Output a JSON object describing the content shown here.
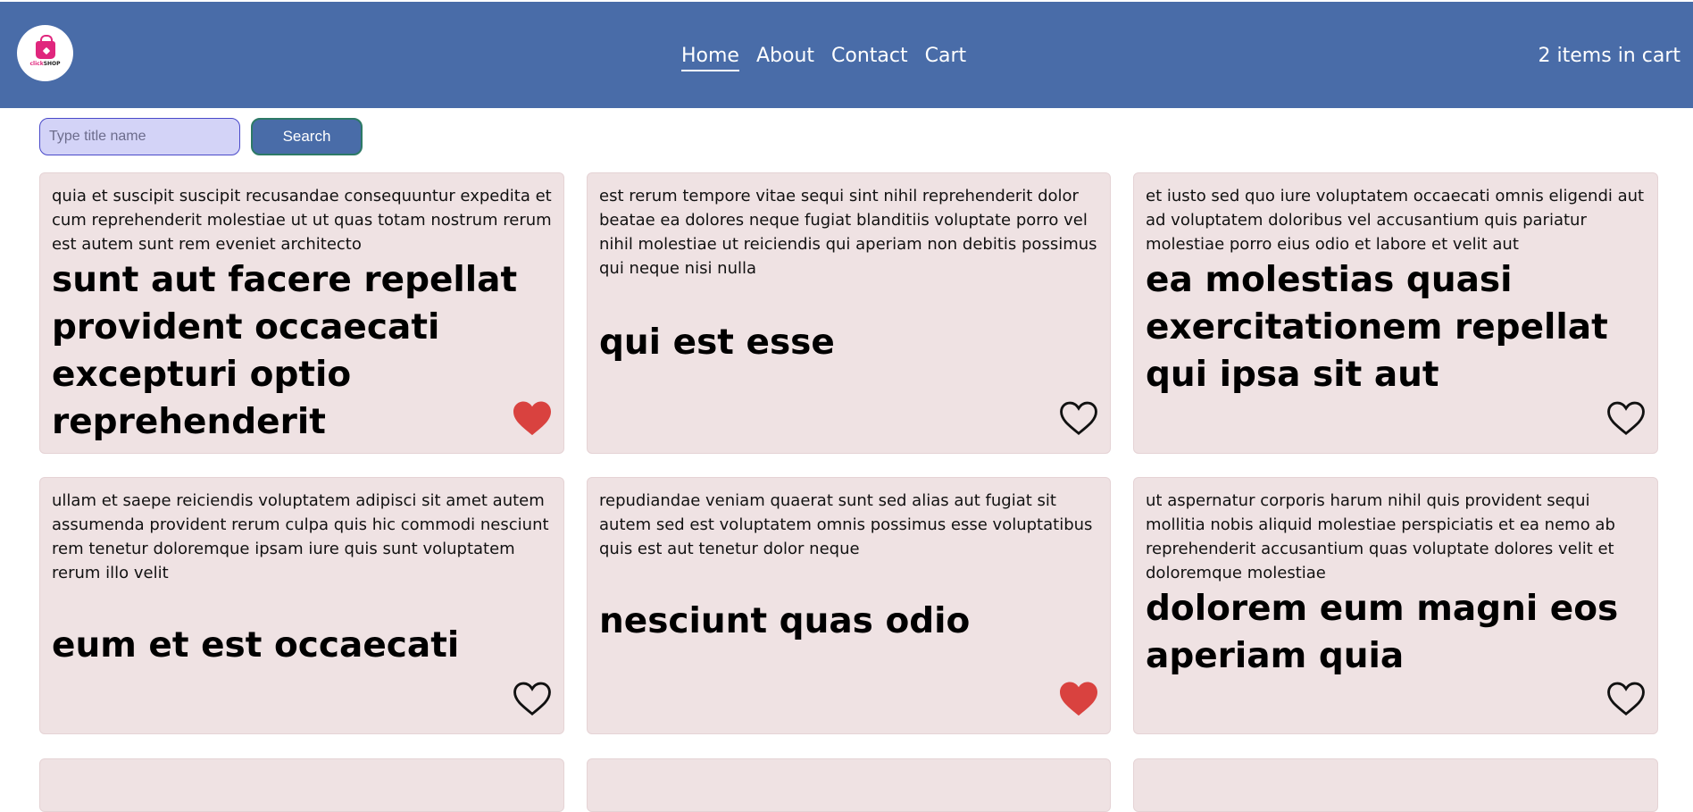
{
  "header": {
    "logo_text": "clickSHOP",
    "nav": [
      {
        "label": "Home",
        "active": true
      },
      {
        "label": "About",
        "active": false
      },
      {
        "label": "Contact",
        "active": false
      },
      {
        "label": "Cart",
        "active": false
      }
    ],
    "cart_status": "2 items in cart"
  },
  "search": {
    "placeholder": "Type title name",
    "value": "",
    "button_label": "Search"
  },
  "colors": {
    "header_bg": "#496ca8",
    "card_bg": "#efe2e3",
    "heart_filled": "#d9423f"
  },
  "posts": [
    {
      "body": "quia et suscipit suscipit recusandae consequuntur expedita et cum reprehenderit molestiae ut ut quas totam nostrum rerum est autem sunt rem eveniet architecto",
      "title": "sunt aut facere repellat provident occaecati excepturi optio reprehenderit",
      "favorited": true
    },
    {
      "body": "est rerum tempore vitae sequi sint nihil reprehenderit dolor beatae ea dolores neque fugiat blanditiis voluptate porro vel nihil molestiae ut reiciendis qui aperiam non debitis possimus qui neque nisi nulla",
      "title": "qui est esse",
      "favorited": false
    },
    {
      "body": "et iusto sed quo iure voluptatem occaecati omnis eligendi aut ad voluptatem doloribus vel accusantium quis pariatur molestiae porro eius odio et labore et velit aut",
      "title": "ea molestias quasi exercitationem repellat qui ipsa sit aut",
      "favorited": false
    },
    {
      "body": "ullam et saepe reiciendis voluptatem adipisci sit amet autem assumenda provident rerum culpa quis hic commodi nesciunt rem tenetur doloremque ipsam iure quis sunt voluptatem rerum illo velit",
      "title": "eum et est occaecati",
      "favorited": false
    },
    {
      "body": "repudiandae veniam quaerat sunt sed alias aut fugiat sit autem sed est voluptatem omnis possimus esse voluptatibus quis est aut tenetur dolor neque",
      "title": "nesciunt quas odio",
      "favorited": true
    },
    {
      "body": "ut aspernatur corporis harum nihil quis provident sequi mollitia nobis aliquid molestiae perspiciatis et ea nemo ab reprehenderit accusantium quas voluptate dolores velit et doloremque molestiae",
      "title": "dolorem eum magni eos aperiam quia",
      "favorited": false
    }
  ]
}
